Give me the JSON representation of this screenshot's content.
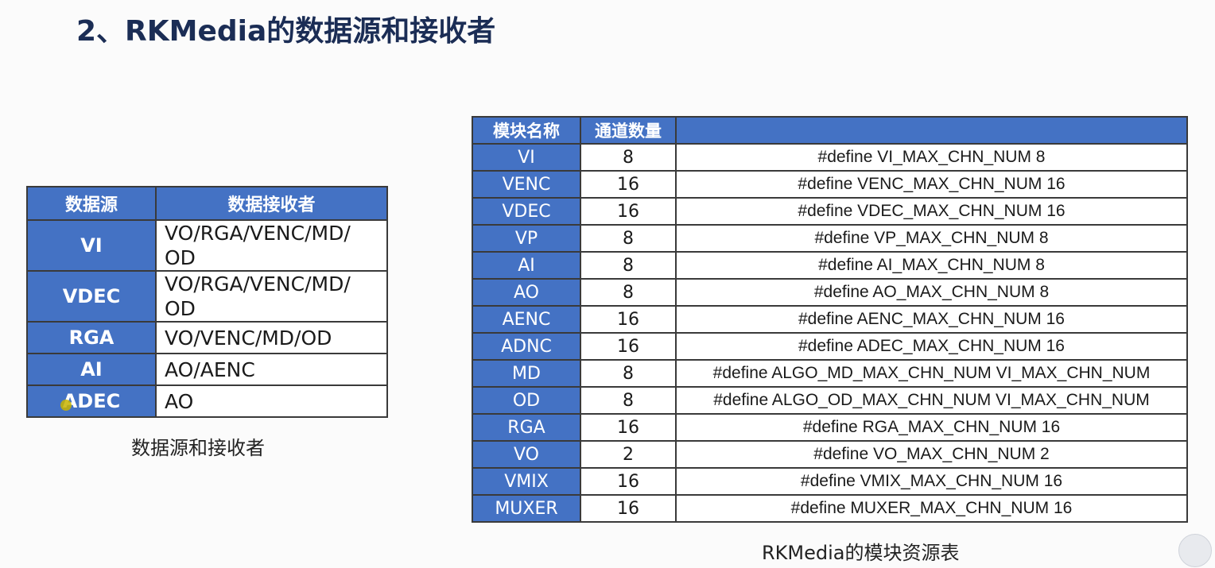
{
  "title": "2、RKMedia的数据源和接收者",
  "left_table": {
    "headers": [
      "数据源",
      "数据接收者"
    ],
    "rows": [
      {
        "source": "VI",
        "receivers": "VO/RGA/VENC/MD/\nOD"
      },
      {
        "source": "VDEC",
        "receivers": "VO/RGA/VENC/MD/\nOD"
      },
      {
        "source": "RGA",
        "receivers": "VO/VENC/MD/OD"
      },
      {
        "source": "AI",
        "receivers": "AO/AENC"
      },
      {
        "source": "ADEC",
        "receivers": "AO"
      }
    ],
    "caption": "数据源和接收者"
  },
  "right_table": {
    "headers": [
      "模块名称",
      "通道数量",
      ""
    ],
    "rows": [
      {
        "module": "VI",
        "count": "8",
        "define": "#define VI_MAX_CHN_NUM 8"
      },
      {
        "module": "VENC",
        "count": "16",
        "define": "#define VENC_MAX_CHN_NUM 16"
      },
      {
        "module": "VDEC",
        "count": "16",
        "define": "#define VDEC_MAX_CHN_NUM 16"
      },
      {
        "module": "VP",
        "count": "8",
        "define": "#define VP_MAX_CHN_NUM 8"
      },
      {
        "module": "AI",
        "count": "8",
        "define": "#define AI_MAX_CHN_NUM 8"
      },
      {
        "module": "AO",
        "count": "8",
        "define": "#define AO_MAX_CHN_NUM 8"
      },
      {
        "module": "AENC",
        "count": "16",
        "define": "#define AENC_MAX_CHN_NUM 16"
      },
      {
        "module": "ADNC",
        "count": "16",
        "define": "#define ADEC_MAX_CHN_NUM 16"
      },
      {
        "module": "MD",
        "count": "8",
        "define": "#define ALGO_MD_MAX_CHN_NUM VI_MAX_CHN_NUM"
      },
      {
        "module": "OD",
        "count": "8",
        "define": "#define ALGO_OD_MAX_CHN_NUM VI_MAX_CHN_NUM"
      },
      {
        "module": "RGA",
        "count": "16",
        "define": "#define RGA_MAX_CHN_NUM 16"
      },
      {
        "module": "VO",
        "count": "2",
        "define": "#define VO_MAX_CHN_NUM 2"
      },
      {
        "module": "VMIX",
        "count": "16",
        "define": "#define VMIX_MAX_CHN_NUM 16"
      },
      {
        "module": "MUXER",
        "count": "16",
        "define": "#define MUXER_MAX_CHN_NUM 16"
      }
    ],
    "caption": "RKMedia的模块资源表"
  },
  "colors": {
    "header_blue": "#4472c4",
    "title_navy": "#1b2d55"
  },
  "icons": {
    "cursor": "mouse-pointer-icon",
    "corner": "floating-widget-icon"
  }
}
